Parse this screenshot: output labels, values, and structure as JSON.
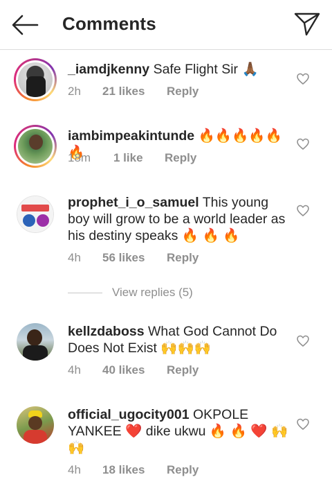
{
  "header": {
    "title": "Comments"
  },
  "comments": [
    {
      "username": "_iamdjkenny",
      "text": "Safe Flight Sir 🙏🏾",
      "time": "2h",
      "likes": "21 likes",
      "reply": "Reply"
    },
    {
      "username": "iambimpeakintunde",
      "text": "🔥🔥🔥🔥🔥🔥",
      "time": "18m",
      "likes": "1 like",
      "reply": "Reply"
    },
    {
      "username": "prophet_i_o_samuel",
      "text": "This young boy will grow to be a world leader as his destiny speaks 🔥 🔥 🔥",
      "time": "4h",
      "likes": "56 likes",
      "reply": "Reply"
    },
    {
      "username": "kellzdaboss",
      "text": "What God Cannot Do Does Not Exist 🙌🙌🙌",
      "time": "4h",
      "likes": "40 likes",
      "reply": "Reply"
    },
    {
      "username": "official_ugocity001",
      "text": "OKPOLE YANKEE ❤️ dike ukwu 🔥 🔥 ❤️ 🙌🙌",
      "time": "4h",
      "likes": "18 likes",
      "reply": "Reply"
    }
  ],
  "view_replies": "View replies (5)",
  "icons": [
    "back-arrow-icon",
    "direct-send-icon",
    "heart-outline-icon"
  ],
  "colors": {
    "text": "#262626",
    "secondary": "#8e8e8e",
    "divider": "#dbdbdb"
  }
}
